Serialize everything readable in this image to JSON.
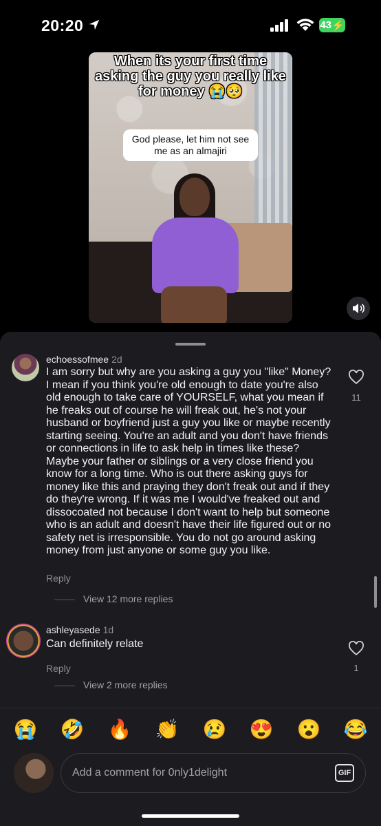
{
  "status_bar": {
    "time": "20:20",
    "battery": "43"
  },
  "video": {
    "caption": "When its your first time asking the guy you really like for money 😭🥺",
    "bubble": "God please, let him not see me as an almajiri"
  },
  "comments": [
    {
      "username": "echoessofmee",
      "ago": "2d",
      "text": "I am sorry but why are you asking a guy you \"like\" Money? I mean if you think you're old enough to date you're also old enough to take care of YOURSELF, what you mean if he freaks out of course he will freak out, he's not your husband or boyfriend just a guy you like or maybe recently starting seeing. You're an adult and you don't have friends or connections in life to ask help in times like these? Maybe your father or siblings or a very close friend you know for a long time. Who is out there asking guys for money like this and praying they don't freak out and if they do they're wrong. If it was me I would've freaked out and dissocoated not because I don't want to help but someone who is an adult and doesn't have their life figured out or no safety net is irresponsible. You do not go around asking money from just anyone or some guy you like.",
      "reply": "Reply",
      "more_replies": "View 12 more replies",
      "likes": "11"
    },
    {
      "username": "ashleyasede",
      "ago": "1d",
      "text": "Can definitely relate",
      "reply": "Reply",
      "more_replies": "View 2 more replies",
      "likes": "1"
    }
  ],
  "emoji_bar": [
    "😭",
    "🤣",
    "🔥",
    "👏",
    "😢",
    "😍",
    "😮",
    "😂"
  ],
  "composer": {
    "placeholder": "Add a comment for 0nly1delight",
    "gif_label": "GIF"
  }
}
